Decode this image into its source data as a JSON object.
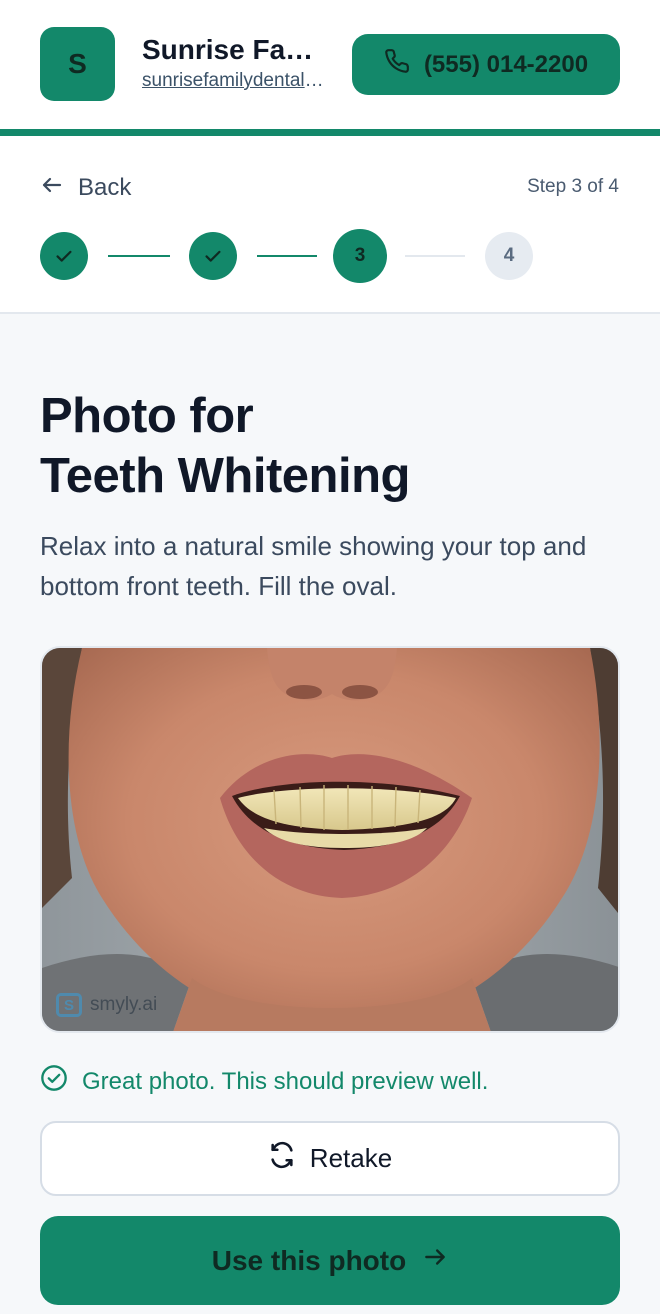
{
  "header": {
    "logo_letter": "S",
    "brand_name": "Sunrise Family Dental",
    "brand_url": "sunrisefamilydental.com",
    "phone": "(555) 014-2200",
    "phone_icon": "phone-icon"
  },
  "progress": {
    "back_label": "Back",
    "step_text": "Step 3 of 4",
    "current_step": 3,
    "total_steps": 4,
    "steps": [
      {
        "label": "",
        "state": "done"
      },
      {
        "label": "",
        "state": "done"
      },
      {
        "label": "3",
        "state": "current"
      },
      {
        "label": "4",
        "state": "todo"
      }
    ]
  },
  "main": {
    "title_line1": "Photo for",
    "title_line2": "Teeth Whitening",
    "subtitle": "Relax into a natural smile showing your top and bottom front teeth. Fill the oval.",
    "photo_watermark": "smyly.ai",
    "status_text": "Great photo. This should preview well.",
    "retake_label": "Retake",
    "use_label": "Use this photo"
  },
  "colors": {
    "accent": "#13886a",
    "background": "#f6f8fa",
    "text": "#101828"
  }
}
